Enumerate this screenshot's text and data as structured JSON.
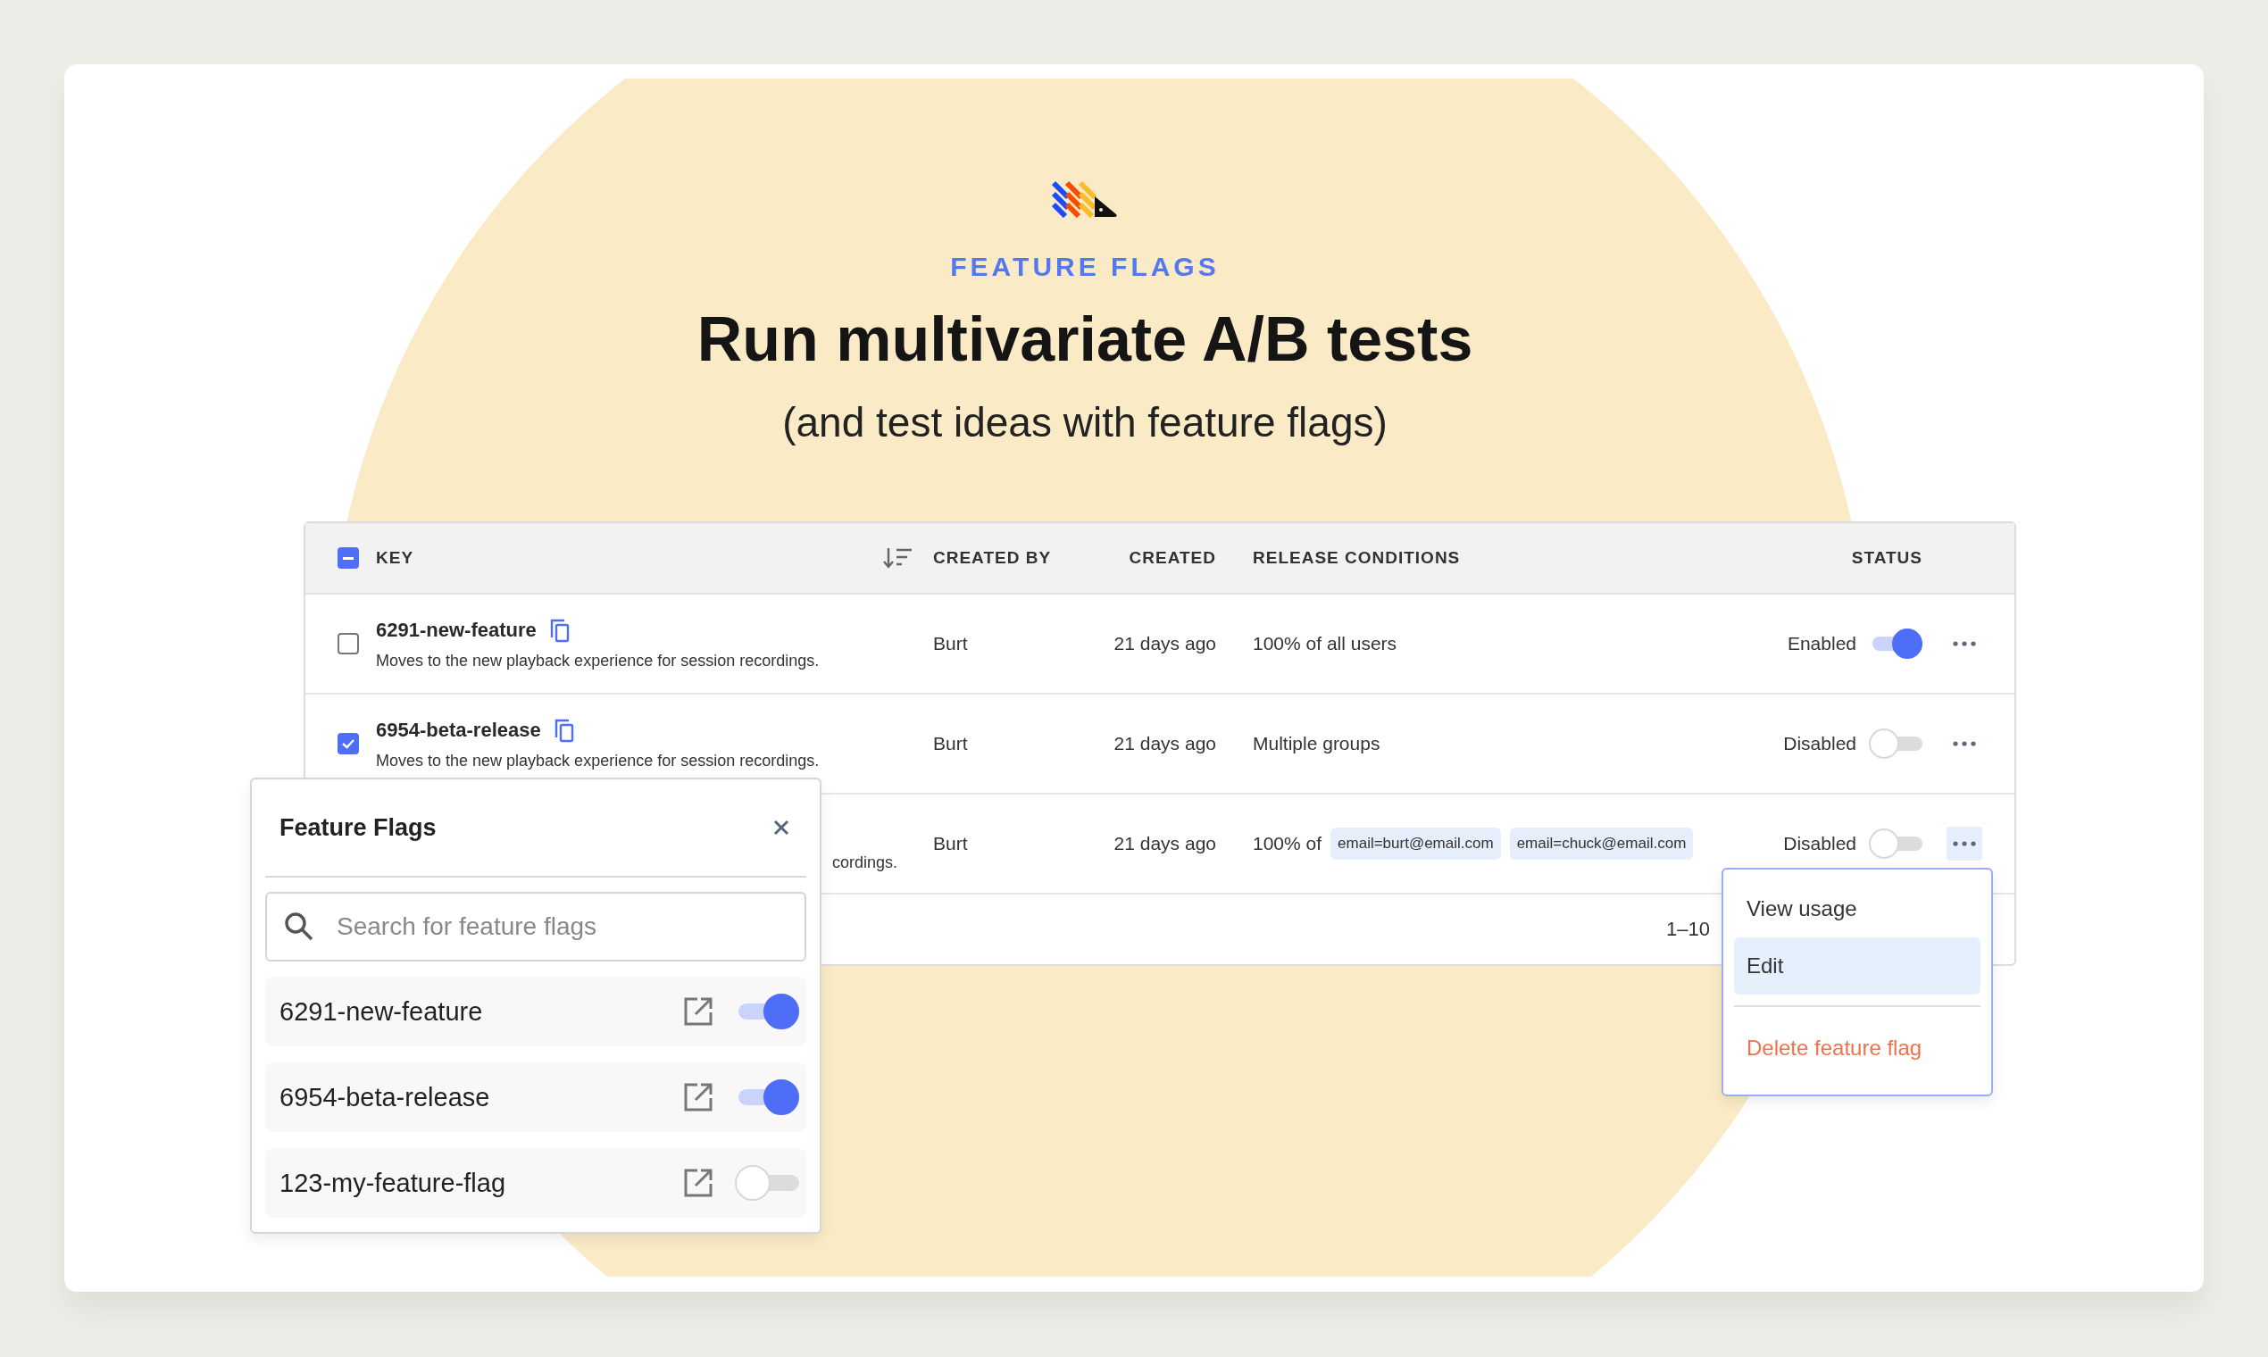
{
  "eyebrow": "FEATURE FLAGS",
  "title": "Run multivariate A/B tests",
  "subtitle": "(and test ideas with feature flags)",
  "table": {
    "select_all": {
      "indeterminate": true
    },
    "columns": [
      {
        "label": "KEY"
      },
      {
        "label": "CREATED BY"
      },
      {
        "label": "CREATED"
      },
      {
        "label": "RELEASE CONDITIONS"
      },
      {
        "label": "STATUS"
      }
    ],
    "rows": [
      {
        "checked": false,
        "key": "6291-new-feature",
        "description": "Moves to the new playback experience for session recordings.",
        "created_by": "Burt",
        "created": "21 days ago",
        "release_text": "100% of all users",
        "status": "Enabled",
        "enabled": true,
        "menu_open": false
      },
      {
        "checked": true,
        "key": "6954-beta-release",
        "description": "Moves to the new playback experience for session recordings.",
        "created_by": "Burt",
        "created": "21 days ago",
        "release_text": "Multiple groups",
        "status": "Disabled",
        "enabled": false,
        "menu_open": false
      },
      {
        "description": "cordings.",
        "created_by": "Burt",
        "created": "21 days ago",
        "release_text": "100% of",
        "release_tags": [
          "email=burt@email.com",
          "email=chuck@email.com"
        ],
        "status": "Disabled",
        "enabled": false,
        "menu_open": true
      }
    ],
    "footer": "1–10"
  },
  "popup": {
    "title": "Feature Flags",
    "search": {
      "placeholder": "Search for feature flags"
    },
    "items": [
      {
        "name": "6291-new-feature",
        "enabled": true
      },
      {
        "name": "6954-beta-release",
        "enabled": true
      },
      {
        "name": "123-my-feature-flag",
        "enabled": false
      }
    ]
  },
  "menu": {
    "items": [
      {
        "label": "View usage",
        "kind": "normal",
        "selected": false
      },
      {
        "label": "Edit",
        "kind": "normal",
        "selected": true
      },
      {
        "label": "Delete feature flag",
        "kind": "danger",
        "selected": false
      }
    ]
  }
}
